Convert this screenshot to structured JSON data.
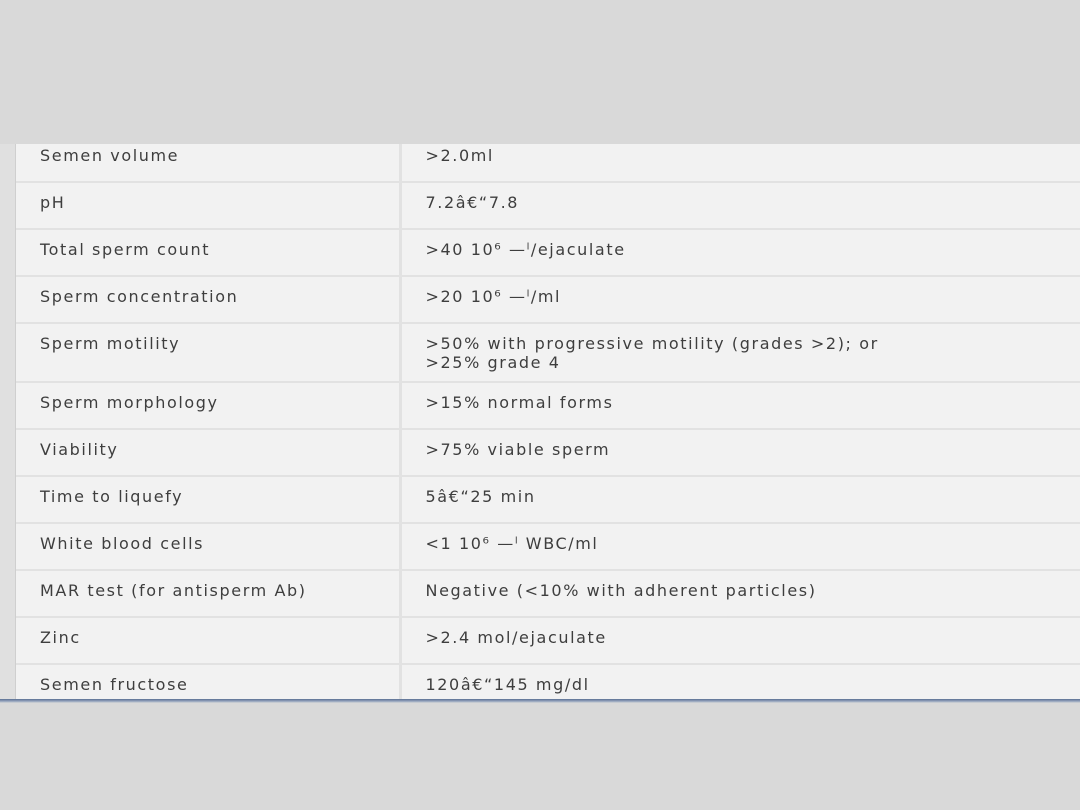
{
  "rows": [
    {
      "parameter": "Semen volume",
      "value": ">2.0ml"
    },
    {
      "parameter": "pH",
      "value": "7.2â€“7.8"
    },
    {
      "parameter": "Total sperm count",
      "value": ">40 10⁶ —ˡ/ejaculate"
    },
    {
      "parameter": "Sperm concentration",
      "value": ">20 10⁶ —ˡ/ml"
    },
    {
      "parameter": "Sperm motility",
      "value": ">50% with progressive motility (grades >2); or",
      "value_line2": ">25% grade 4"
    },
    {
      "parameter": "Sperm morphology",
      "value": ">15% normal forms"
    },
    {
      "parameter": "Viability",
      "value": ">75% viable sperm"
    },
    {
      "parameter": "Time to liquefy",
      "value": "5â€“25 min"
    },
    {
      "parameter": "White blood cells",
      "value": "<1 10⁶ —ˡ WBC/ml"
    },
    {
      "parameter": "MAR test (for antisperm Ab)",
      "value": "Negative (<10% with adherent particles)"
    },
    {
      "parameter": "Zinc",
      "value": ">2.4 mol/ejaculate"
    },
    {
      "parameter": "Semen fructose",
      "value": "120â€“145 mg/dl"
    }
  ]
}
